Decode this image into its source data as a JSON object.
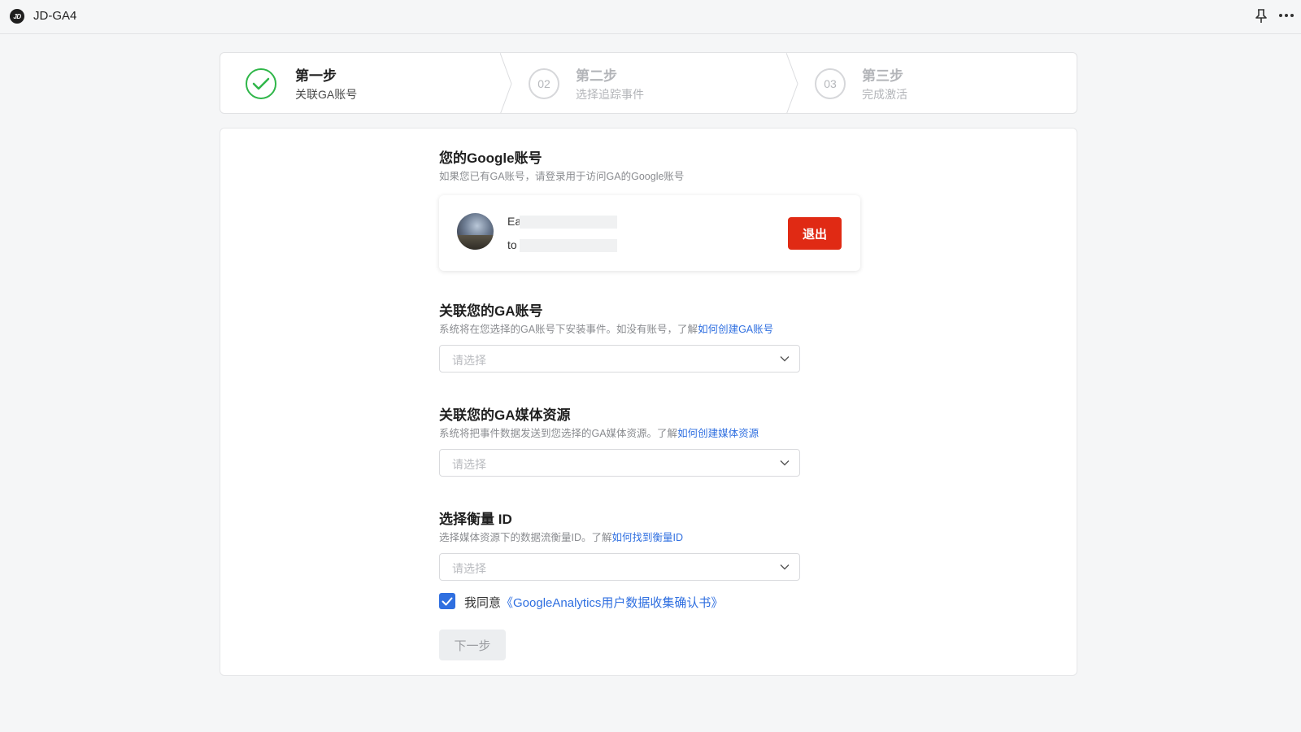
{
  "app": {
    "logo_text": "JD",
    "title": "JD-GA4"
  },
  "steps": [
    {
      "number": "",
      "title": "第一步",
      "subtitle": "关联GA账号",
      "state": "done"
    },
    {
      "number": "02",
      "title": "第二步",
      "subtitle": "选择追踪事件",
      "state": "inactive"
    },
    {
      "number": "03",
      "title": "第三步",
      "subtitle": "完成激活",
      "state": "inactive"
    }
  ],
  "google_account": {
    "title": "您的Google账号",
    "desc": "如果您已有GA账号，请登录用于访问GA的Google账号",
    "name_prefix": "Ea",
    "email_prefix": "to",
    "logout_label": "退出"
  },
  "ga_account": {
    "title": "关联您的GA账号",
    "desc": "系统将在您选择的GA账号下安装事件。如没有账号，了解",
    "link": "如何创建GA账号",
    "placeholder": "请选择"
  },
  "ga_property": {
    "title": "关联您的GA媒体资源",
    "desc": "系统将把事件数据发送到您选择的GA媒体资源。了解",
    "link": "如何创建媒体资源",
    "placeholder": "请选择"
  },
  "measurement_id": {
    "title": "选择衡量 ID",
    "desc": "选择媒体资源下的数据流衡量ID。了解",
    "link": "如何找到衡量ID",
    "placeholder": "请选择"
  },
  "agreement": {
    "checked": true,
    "text": "我同意",
    "link": "《GoogleAnalytics用户数据收集确认书》"
  },
  "next_button": "下一步",
  "colors": {
    "accent": "#2f6fe0",
    "success": "#2fb649",
    "danger": "#e02a14"
  }
}
